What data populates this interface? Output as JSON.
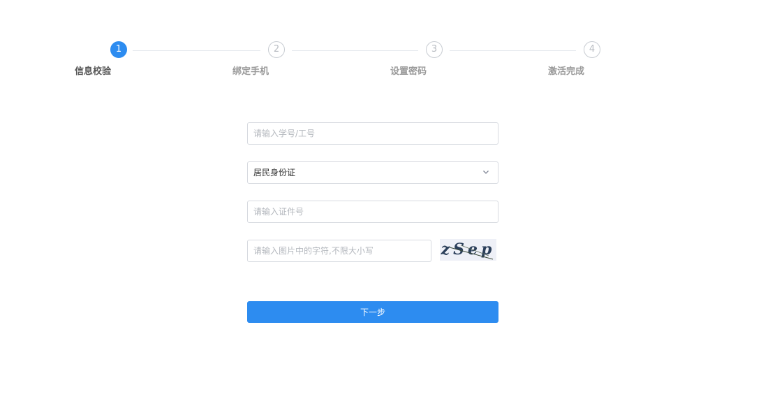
{
  "steps": [
    {
      "number": "1",
      "label": "信息校验",
      "active": true
    },
    {
      "number": "2",
      "label": "绑定手机",
      "active": false
    },
    {
      "number": "3",
      "label": "设置密码",
      "active": false
    },
    {
      "number": "4",
      "label": "激活完成",
      "active": false
    }
  ],
  "form": {
    "id_number_placeholder": "请输入学号/工号",
    "id_type_value": "居民身份证",
    "certificate_placeholder": "请输入证件号",
    "captcha_placeholder": "请输入图片中的字符,不限大小写",
    "captcha_image_text": "zSep",
    "next_button": "下一步"
  },
  "colors": {
    "accent": "#2d8cf0",
    "border": "#d7dae0",
    "inactive_step": "#b8bcc2"
  },
  "icons": {
    "select_arrow": "chevron-down-icon"
  }
}
